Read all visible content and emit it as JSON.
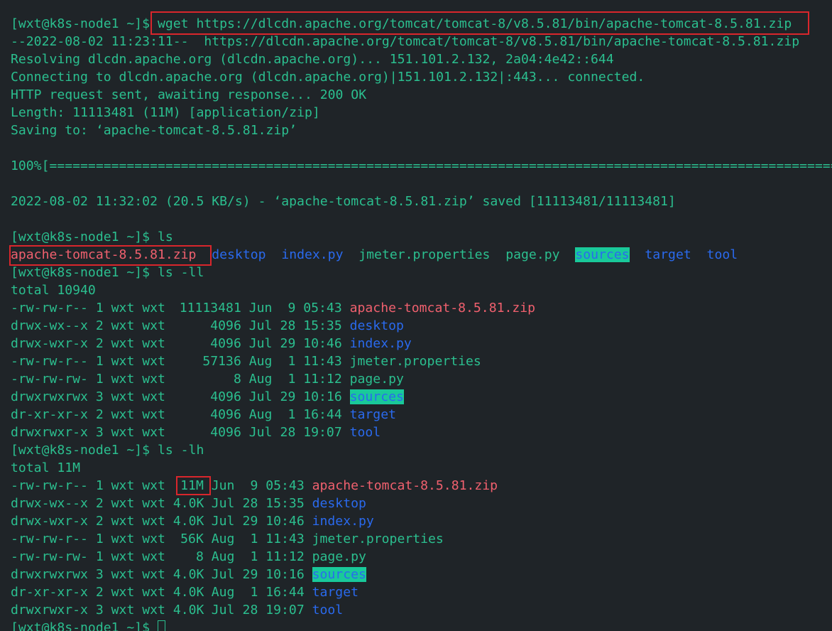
{
  "terminal": {
    "colors": {
      "background": "#1f2428",
      "text": "#2bbf8f",
      "directory": "#2a6aee",
      "archive": "#f0606e",
      "highlight_bg": "#19c99a",
      "annotation_box": "#d9262c"
    },
    "prompt": "[wxt@k8s-node1 ~]$ ",
    "wget": {
      "command": "wget https://dlcdn.apache.org/tomcat/tomcat-8/v8.5.81/bin/apache-tomcat-8.5.81.zip",
      "output": [
        "--2022-08-02 11:23:11--  https://dlcdn.apache.org/tomcat/tomcat-8/v8.5.81/bin/apache-tomcat-8.5.81.zip",
        "Resolving dlcdn.apache.org (dlcdn.apache.org)... 151.101.2.132, 2a04:4e42::644",
        "Connecting to dlcdn.apache.org (dlcdn.apache.org)|151.101.2.132|:443... connected.",
        "HTTP request sent, awaiting response... 200 OK",
        "Length: 11113481 (11M) [application/zip]",
        "Saving to: ‘apache-tomcat-8.5.81.zip’"
      ],
      "progress": "100%[==========================================================================================================",
      "saved": "2022-08-02 11:32:02 (20.5 KB/s) - ‘apache-tomcat-8.5.81.zip’ saved [11113481/11113481]"
    },
    "ls": {
      "command": "ls",
      "files": [
        {
          "name": "apache-tomcat-8.5.81.zip",
          "type": "archive"
        },
        {
          "name": "desktop",
          "type": "dir"
        },
        {
          "name": "index.py",
          "type": "dir"
        },
        {
          "name": "jmeter.properties",
          "type": "file"
        },
        {
          "name": "page.py",
          "type": "file"
        },
        {
          "name": "sources",
          "type": "dir-highlight"
        },
        {
          "name": "target",
          "type": "dir"
        },
        {
          "name": "tool",
          "type": "dir"
        }
      ]
    },
    "ls_ll": {
      "command": "ls -ll",
      "total": "total 10940",
      "rows": [
        {
          "perm": "-rw-rw-r--",
          "links": "1",
          "user": "wxt",
          "group": "wxt",
          "size": "11113481",
          "month": "Jun",
          "day": "9",
          "time": "05:43",
          "name": "apache-tomcat-8.5.81.zip",
          "type": "archive"
        },
        {
          "perm": "drwx-wx--x",
          "links": "2",
          "user": "wxt",
          "group": "wxt",
          "size": "4096",
          "month": "Jul",
          "day": "28",
          "time": "15:35",
          "name": "desktop",
          "type": "dir"
        },
        {
          "perm": "drwx-wxr-x",
          "links": "2",
          "user": "wxt",
          "group": "wxt",
          "size": "4096",
          "month": "Jul",
          "day": "29",
          "time": "10:46",
          "name": "index.py",
          "type": "dir"
        },
        {
          "perm": "-rw-rw-r--",
          "links": "1",
          "user": "wxt",
          "group": "wxt",
          "size": "57136",
          "month": "Aug",
          "day": "1",
          "time": "11:43",
          "name": "jmeter.properties",
          "type": "file"
        },
        {
          "perm": "-rw-rw-rw-",
          "links": "1",
          "user": "wxt",
          "group": "wxt",
          "size": "8",
          "month": "Aug",
          "day": "1",
          "time": "11:12",
          "name": "page.py",
          "type": "file"
        },
        {
          "perm": "drwxrwxrwx",
          "links": "3",
          "user": "wxt",
          "group": "wxt",
          "size": "4096",
          "month": "Jul",
          "day": "29",
          "time": "10:16",
          "name": "sources",
          "type": "dir-highlight"
        },
        {
          "perm": "dr-xr-xr-x",
          "links": "2",
          "user": "wxt",
          "group": "wxt",
          "size": "4096",
          "month": "Aug",
          "day": "1",
          "time": "16:44",
          "name": "target",
          "type": "dir"
        },
        {
          "perm": "drwxrwxr-x",
          "links": "3",
          "user": "wxt",
          "group": "wxt",
          "size": "4096",
          "month": "Jul",
          "day": "28",
          "time": "19:07",
          "name": "tool",
          "type": "dir"
        }
      ]
    },
    "ls_lh": {
      "command": "ls -lh",
      "total": "total 11M",
      "rows": [
        {
          "perm": "-rw-rw-r--",
          "links": "1",
          "user": "wxt",
          "group": "wxt",
          "size": "11M",
          "month": "Jun",
          "day": "9",
          "time": "05:43",
          "name": "apache-tomcat-8.5.81.zip",
          "type": "archive"
        },
        {
          "perm": "drwx-wx--x",
          "links": "2",
          "user": "wxt",
          "group": "wxt",
          "size": "4.0K",
          "month": "Jul",
          "day": "28",
          "time": "15:35",
          "name": "desktop",
          "type": "dir"
        },
        {
          "perm": "drwx-wxr-x",
          "links": "2",
          "user": "wxt",
          "group": "wxt",
          "size": "4.0K",
          "month": "Jul",
          "day": "29",
          "time": "10:46",
          "name": "index.py",
          "type": "dir"
        },
        {
          "perm": "-rw-rw-r--",
          "links": "1",
          "user": "wxt",
          "group": "wxt",
          "size": "56K",
          "month": "Aug",
          "day": "1",
          "time": "11:43",
          "name": "jmeter.properties",
          "type": "file"
        },
        {
          "perm": "-rw-rw-rw-",
          "links": "1",
          "user": "wxt",
          "group": "wxt",
          "size": "8",
          "month": "Aug",
          "day": "1",
          "time": "11:12",
          "name": "page.py",
          "type": "file"
        },
        {
          "perm": "drwxrwxrwx",
          "links": "3",
          "user": "wxt",
          "group": "wxt",
          "size": "4.0K",
          "month": "Jul",
          "day": "29",
          "time": "10:16",
          "name": "sources",
          "type": "dir-highlight"
        },
        {
          "perm": "dr-xr-xr-x",
          "links": "2",
          "user": "wxt",
          "group": "wxt",
          "size": "4.0K",
          "month": "Aug",
          "day": "1",
          "time": "16:44",
          "name": "target",
          "type": "dir"
        },
        {
          "perm": "drwxrwxr-x",
          "links": "3",
          "user": "wxt",
          "group": "wxt",
          "size": "4.0K",
          "month": "Jul",
          "day": "28",
          "time": "19:07",
          "name": "tool",
          "type": "dir"
        }
      ]
    }
  }
}
